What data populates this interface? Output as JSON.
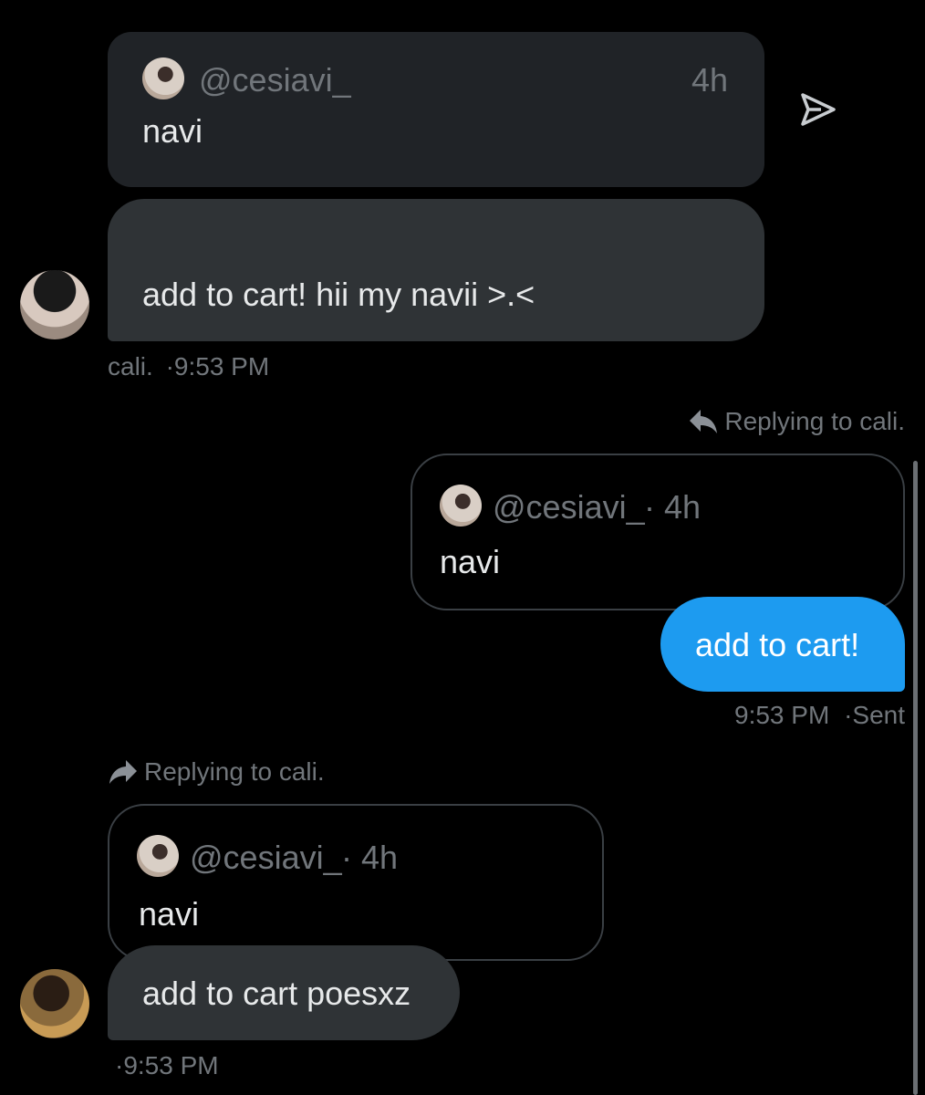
{
  "messages": [
    {
      "quote": {
        "handle": "@cesiavi_",
        "time": "4h",
        "text": "navi"
      },
      "text": "add to cart! hii my navii >.<",
      "meta": {
        "sender": "cali.",
        "time": "·9:53 PM"
      }
    },
    {
      "reply_label": "Replying to cali.",
      "quote": {
        "handle": "@cesiavi_",
        "time": "· 4h",
        "text": "navi"
      },
      "text": "add to cart!",
      "meta": {
        "time": "9:53 PM",
        "status": "·Sent"
      }
    },
    {
      "reply_label": "Replying to cali.",
      "quote": {
        "handle": "@cesiavi_",
        "time": "· 4h",
        "text": "navi"
      },
      "text": "add to cart poesxz",
      "meta": {
        "time": "·9:53 PM"
      }
    }
  ],
  "icons": {
    "share": "send-icon",
    "reply": "reply-arrow-icon",
    "forward": "forward-arrow-icon"
  },
  "colors": {
    "background": "#000000",
    "incoming_bubble": "#2f3336",
    "outgoing_bubble": "#1d9bf0",
    "quote_fill": "#202327",
    "muted_text": "#71767b"
  }
}
